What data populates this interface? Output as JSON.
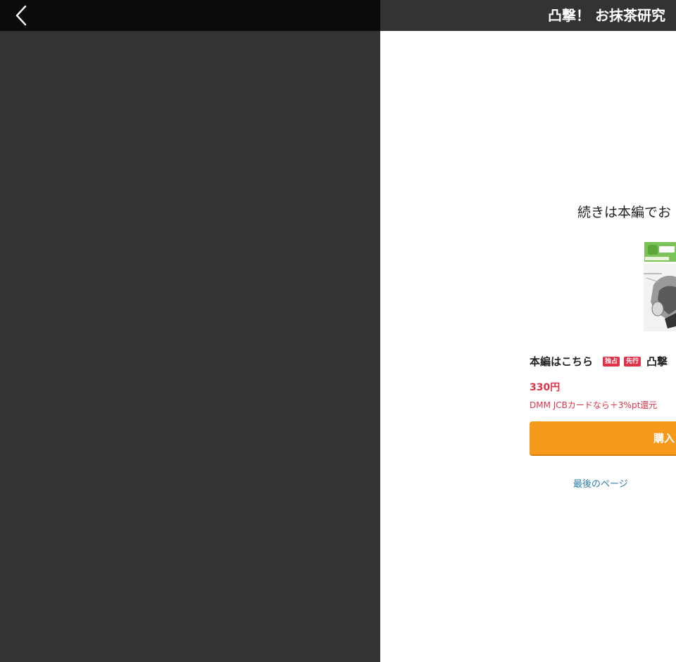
{
  "header": {
    "back_icon": "chevron-left-icon",
    "title": "凸撃！ お抹茶研究"
  },
  "colors": {
    "left_background": "#333333",
    "left_topbar": "#0b0b0b",
    "right_topbar": "#333333",
    "accent_red": "#e0334a",
    "buy_button": "#f79a1c",
    "link": "#2a7da8"
  },
  "end_panel": {
    "continue_text": "続きは本編でお",
    "product_lead": "本編はこちら",
    "tags": [
      "独占",
      "先行"
    ],
    "product_name": "凸撃",
    "price": "330円",
    "promo": "DMM JCBカードなら＋3%pt還元",
    "buy_label": "購入",
    "last_page_link": "最後のページ"
  }
}
